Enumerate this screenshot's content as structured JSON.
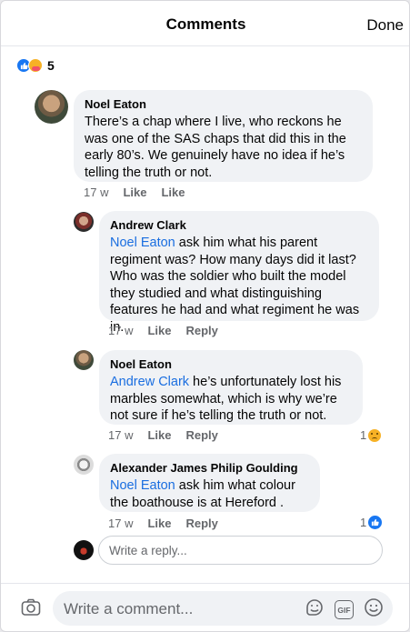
{
  "header": {
    "title": "Comments",
    "done_label": "Done"
  },
  "reactions": {
    "count": "5",
    "icons": [
      "like-icon",
      "care-icon"
    ],
    "like_color": "#1877f2"
  },
  "comments": [
    {
      "author": "Noel Eaton",
      "text": "There’s a chap where I live, who reckons he was one of the SAS chaps that did this in the early 80’s. We genuinely have no idea if he’s telling the truth or not.",
      "time": "17 w",
      "like_label": "Like",
      "reply_label": "Like"
    },
    {
      "author": "Andrew Clark",
      "mention": "Noel Eaton",
      "text": " ask him what his parent regiment was? How many days did it last? Who was the soldier who built the model they studied and what distinguishing features he had and what regiment he was in.",
      "time": "17 w",
      "like_label": "Like",
      "reply_label": "Reply"
    },
    {
      "author": "Noel Eaton",
      "mention": "Andrew Clark",
      "text": " he’s unfortunately lost his marbles somewhat, which is why we’re not sure if he’s telling the truth or not.",
      "time": "17 w",
      "like_label": "Like",
      "reply_label": "Reply",
      "reaction_count": "1",
      "reaction_icon": "sad-icon"
    },
    {
      "author": "Alexander James Philip Goulding",
      "mention": "Noel Eaton",
      "text": " ask him what colour the boathouse is at Hereford .",
      "time": "17 w",
      "like_label": "Like",
      "reply_label": "Reply",
      "reaction_count": "1",
      "reaction_icon": "like-icon"
    }
  ],
  "reply_input": {
    "placeholder": "Write a reply..."
  },
  "comment_input": {
    "placeholder": "Write a comment..."
  },
  "colors": {
    "mention": "#1a6ee0",
    "bubble": "#f0f2f5",
    "meta": "#65676b"
  }
}
